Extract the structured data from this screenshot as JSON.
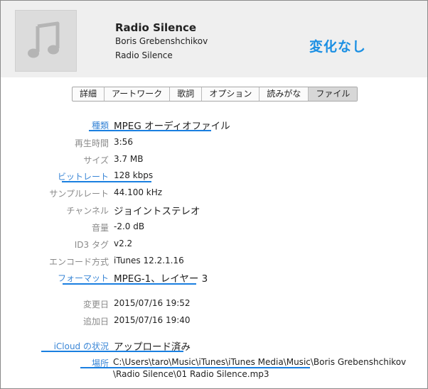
{
  "header": {
    "title": "Radio Silence",
    "artist": "Boris Grebenshchikov",
    "album": "Radio Silence",
    "artwork_icon": "music-note-icon",
    "annotation": "変化なし"
  },
  "tabs": [
    "詳細",
    "アートワーク",
    "歌詞",
    "オプション",
    "読みがな",
    "ファイル"
  ],
  "active_tab": "ファイル",
  "fields": {
    "kind": {
      "label": "種類",
      "value": "MPEG オーディオファイル"
    },
    "duration": {
      "label": "再生時間",
      "value": "3:56"
    },
    "size": {
      "label": "サイズ",
      "value": "3.7 MB"
    },
    "bitrate": {
      "label": "ビットレート",
      "value": "128 kbps"
    },
    "sample_rate": {
      "label": "サンプルレート",
      "value": "44.100 kHz"
    },
    "channels": {
      "label": "チャンネル",
      "value": "ジョイントステレオ"
    },
    "volume": {
      "label": "音量",
      "value": "-2.0 dB"
    },
    "id3": {
      "label": "ID3 タグ",
      "value": "v2.2"
    },
    "encoder": {
      "label": "エンコード方式",
      "value": "iTunes 12.2.1.16"
    },
    "format": {
      "label": "フォーマット",
      "value": "MPEG-1、レイヤー 3"
    },
    "modified": {
      "label": "変更日",
      "value": "2015/07/16 19:52"
    },
    "added": {
      "label": "追加日",
      "value": "2015/07/16 19:40"
    },
    "icloud": {
      "label": "iCloud の状況",
      "value": "アップロード済み"
    },
    "location": {
      "label": "場所",
      "value_line1": "C:\\Users\\taro\\Music\\iTunes\\iTunes Media\\Music\\Boris Grebenshchikov",
      "value_line2": "\\Radio Silence\\01 Radio Silence.mp3"
    }
  },
  "colors": {
    "accent": "#1a7fe0",
    "label_gray": "#8a8a8a",
    "label_highlight": "#3a86d6",
    "header_bg": "#efefef"
  }
}
